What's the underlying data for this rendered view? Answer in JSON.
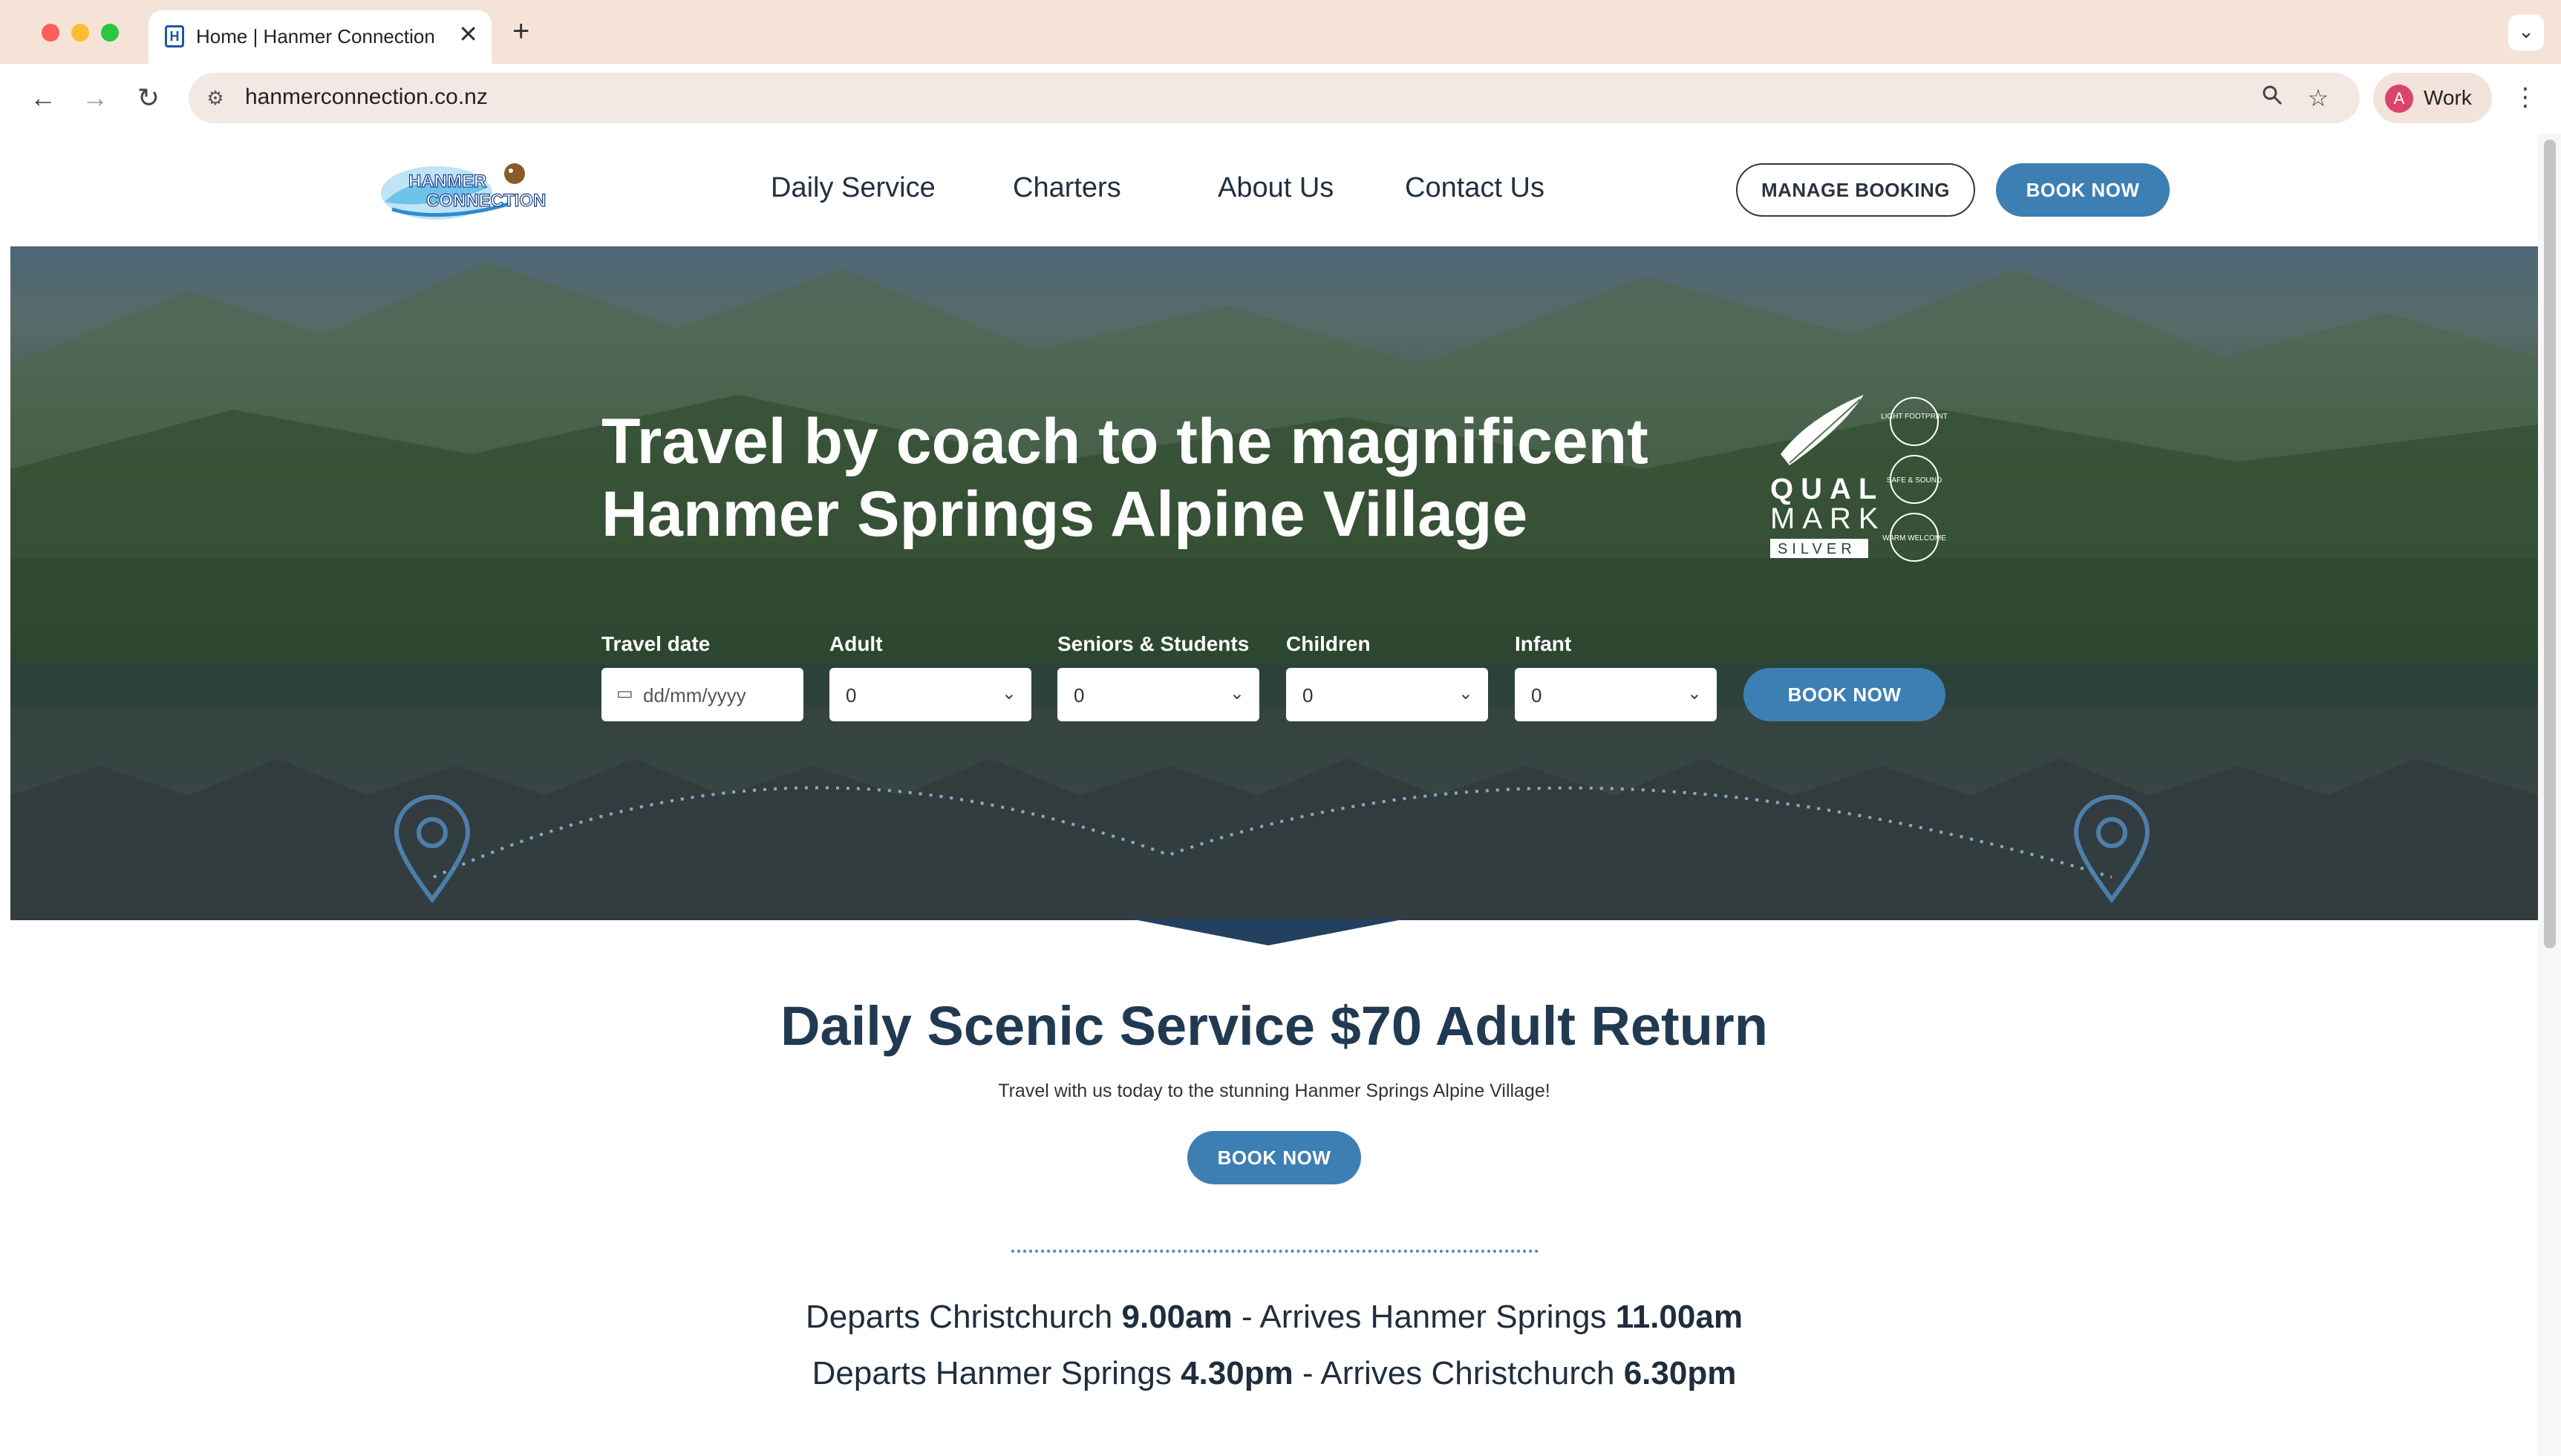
{
  "browser": {
    "tab_title": "Home | Hanmer Connection",
    "tab_favicon": "H",
    "tab_close": "✕",
    "new_tab": "+",
    "tab_menu": "⌄",
    "url": "hanmerconnection.co.nz",
    "profile_initial": "A",
    "profile_name": "Work",
    "icons": [
      "back-icon",
      "forward-icon",
      "reload-icon",
      "site-settings-icon",
      "zoom-icon",
      "star-icon",
      "more-icon"
    ]
  },
  "header": {
    "logo_text": [
      "HANMER",
      "CONNECTION"
    ],
    "nav": [
      "Daily Service",
      "Charters",
      "About Us",
      "Contact Us"
    ],
    "manage_booking": "MANAGE BOOKING",
    "book_now": "BOOK NOW"
  },
  "hero": {
    "title_line1": "Travel by coach to the magnificent",
    "title_line2": "Hanmer Springs Alpine Village",
    "qualmark": {
      "line1": "QUAL",
      "line2": "MARK",
      "level": "SILVER",
      "badges": [
        "LIGHT FOOTPRINT",
        "SAFE & SOUND",
        "WARM WELCOME"
      ]
    },
    "form": {
      "travel_date_label": "Travel date",
      "travel_date_placeholder": "dd/mm/yyyy",
      "adult_label": "Adult",
      "adult_value": "0",
      "seniors_label": "Seniors & Students",
      "seniors_value": "0",
      "children_label": "Children",
      "children_value": "0",
      "infant_label": "Infant",
      "infant_value": "0",
      "book_now": "BOOK NOW"
    }
  },
  "content": {
    "title": "Daily Scenic Service $70 Adult Return",
    "subtitle": "Travel with us today to the stunning Hanmer Springs Alpine Village!",
    "book_now": "BOOK NOW",
    "schedule": [
      {
        "depart_text": "Departs Christchurch ",
        "depart_time": "9.00am",
        "sep": " - ",
        "arrive_text": "Arrives Hanmer Springs ",
        "arrive_time": "11.00am"
      },
      {
        "depart_text": "Departs Hanmer Springs ",
        "depart_time": "4.30pm",
        "sep": " - ",
        "arrive_text": "Arrives Christchurch ",
        "arrive_time": "6.30pm"
      }
    ]
  },
  "colors": {
    "accent_blue": "#3d7fb2",
    "heading_navy": "#213a52",
    "chrome_peach": "#f6e3d8"
  }
}
